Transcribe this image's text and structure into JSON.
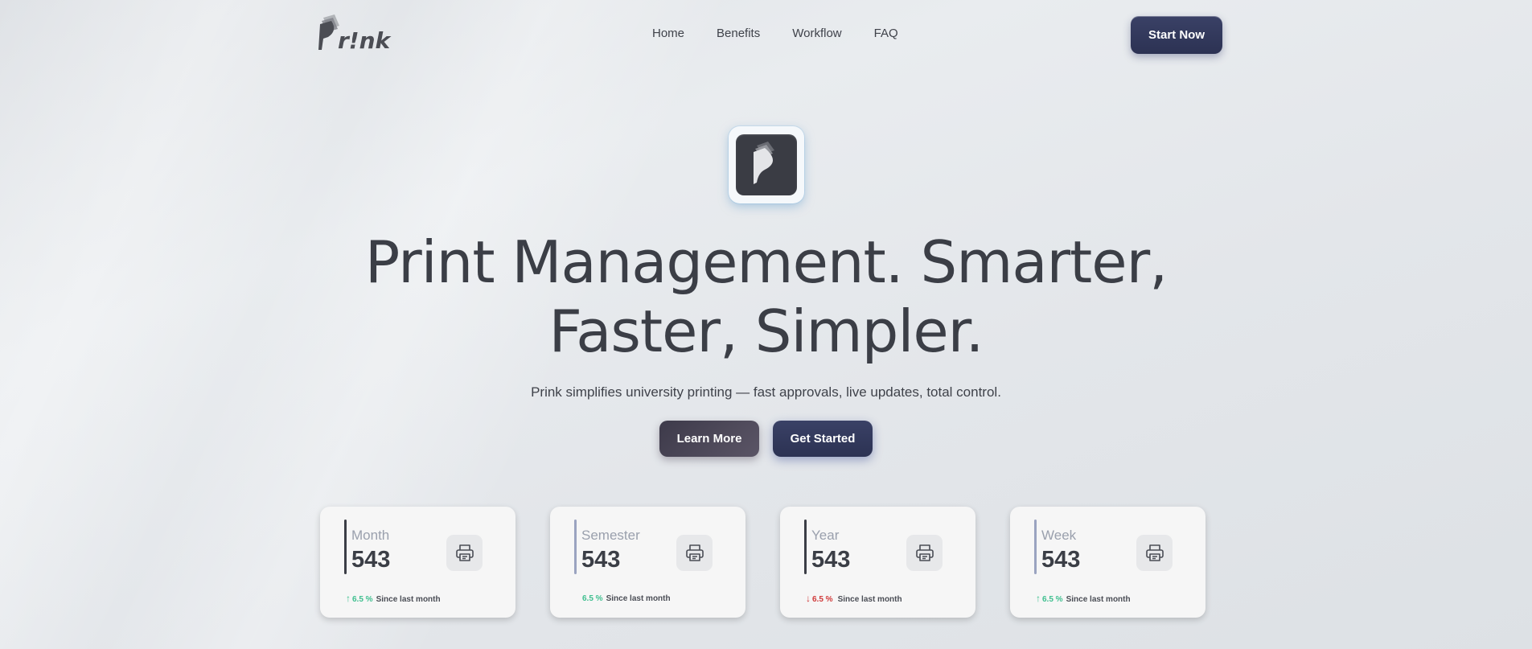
{
  "brand": {
    "name": "Prink",
    "logo_text": "r!nk"
  },
  "nav": {
    "links": [
      "Home",
      "Benefits",
      "Workflow",
      "FAQ"
    ],
    "cta_label": "Start Now"
  },
  "hero": {
    "headline_line1": "Print Management. Smarter,",
    "headline_line2": "Faster, Simpler.",
    "subtitle": "Prink simplifies university printing — fast approvals, live updates, total control.",
    "learn_more_label": "Learn More",
    "get_started_label": "Get Started"
  },
  "stats": [
    {
      "label": "Month",
      "value": "543",
      "change": "6.5 %",
      "trend": "up",
      "since": "Since last month",
      "bar_color": "#3b3e46",
      "trend_color": "#3fbf8f"
    },
    {
      "label": "Semester",
      "value": "543",
      "change": "6.5 %",
      "trend": "none",
      "since": "Since last month",
      "bar_color": "#9aa3c0",
      "trend_color": "#3fbf8f"
    },
    {
      "label": "Year",
      "value": "543",
      "change": "6.5 %",
      "trend": "down",
      "since": "Since last month",
      "bar_color": "#3b3e46",
      "trend_color": "#d03a3a"
    },
    {
      "label": "Week",
      "value": "543",
      "change": "6.5 %",
      "trend": "up",
      "since": "Since last month",
      "bar_color": "#9aa3c0",
      "trend_color": "#3fbf8f"
    }
  ],
  "icons": {
    "stat_card": "printer-icon",
    "arrow_up": "arrow-up-icon",
    "arrow_down": "arrow-down-icon"
  }
}
